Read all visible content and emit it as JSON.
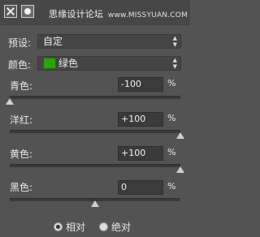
{
  "watermark": {
    "text": "思缘设计论坛",
    "url": "www.MISSYUAN.COM"
  },
  "preset": {
    "label": "预设:",
    "value": "自定"
  },
  "colors": {
    "label": "颜色:",
    "value": "绿色",
    "swatch": "#2ea10c"
  },
  "sliders": [
    {
      "label": "青色:",
      "value": "-100",
      "unit": "%",
      "level": -100
    },
    {
      "label": "洋红:",
      "value": "+100",
      "unit": "%",
      "level": 100
    },
    {
      "label": "黄色:",
      "value": "+100",
      "unit": "%",
      "level": 100
    },
    {
      "label": "黑色:",
      "value": "0",
      "unit": "%",
      "level": 0
    }
  ],
  "method": {
    "relative": "相对",
    "absolute": "绝对",
    "selected": "relative"
  }
}
